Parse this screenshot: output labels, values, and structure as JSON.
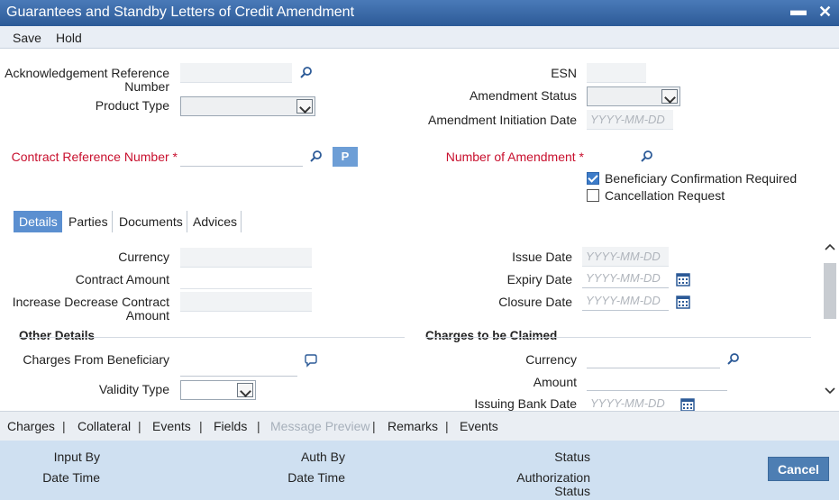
{
  "window": {
    "title": "Guarantees and Standby Letters of Credit Amendment",
    "minimize": "▬",
    "close": "✕"
  },
  "menu": {
    "save": "Save",
    "hold": "Hold"
  },
  "header": {
    "ack_ref_label_line1": "Acknowledgement Reference",
    "ack_ref_label_line2": "Number",
    "ack_ref_value": "",
    "product_type_label": "Product Type",
    "product_type_value": "",
    "esn_label": "ESN",
    "esn_value": "",
    "amend_status_label": "Amendment Status",
    "amend_status_value": "",
    "amend_init_date_label": "Amendment Initiation Date",
    "amend_init_date_placeholder": "YYYY-MM-DD",
    "contract_ref_label": "Contract Reference Number *",
    "contract_ref_value": "",
    "p_button": "P",
    "num_amend_label": "Number of Amendment *",
    "num_amend_value": "",
    "benef_confirm_label": "Beneficiary Confirmation Required",
    "benef_confirm_checked": true,
    "cancel_req_label": "Cancellation Request",
    "cancel_req_checked": false
  },
  "tabs": [
    "Details",
    "Parties",
    "Documents",
    "Advices"
  ],
  "details": {
    "currency_label": "Currency",
    "contract_amount_label": "Contract Amount",
    "incr_decr_label_line1": "Increase Decrease Contract",
    "incr_decr_label_line2": "Amount",
    "issue_date_label": "Issue Date",
    "expiry_date_label": "Expiry Date",
    "closure_date_label": "Closure Date",
    "date_placeholder": "YYYY-MM-DD",
    "other_details_heading": "Other Details",
    "charges_from_benef_label": "Charges From Beneficiary",
    "validity_type_label": "Validity Type",
    "validity_type_value": "",
    "charges_claimed_heading": "Charges to be Claimed",
    "charges_currency_label": "Currency",
    "charges_amount_label": "Amount",
    "issuing_bank_date_label": "Issuing Bank Date"
  },
  "bottom_links": [
    "Charges",
    "Collateral",
    "Events",
    "Fields",
    "Message Preview",
    "Remarks",
    "Events"
  ],
  "footer": {
    "input_by_label": "Input By",
    "date_time_label": "Date Time",
    "auth_by_label": "Auth By",
    "date_time2_label": "Date Time",
    "status_label": "Status",
    "auth_status_line1": "Authorization",
    "auth_status_line2": "Status",
    "cancel_button": "Cancel"
  },
  "colors": {
    "title_bar": "#2c5a97",
    "required_label": "#c8102e",
    "active_tab": "#5b8fd0",
    "footer_bg": "#cfe0f1"
  }
}
